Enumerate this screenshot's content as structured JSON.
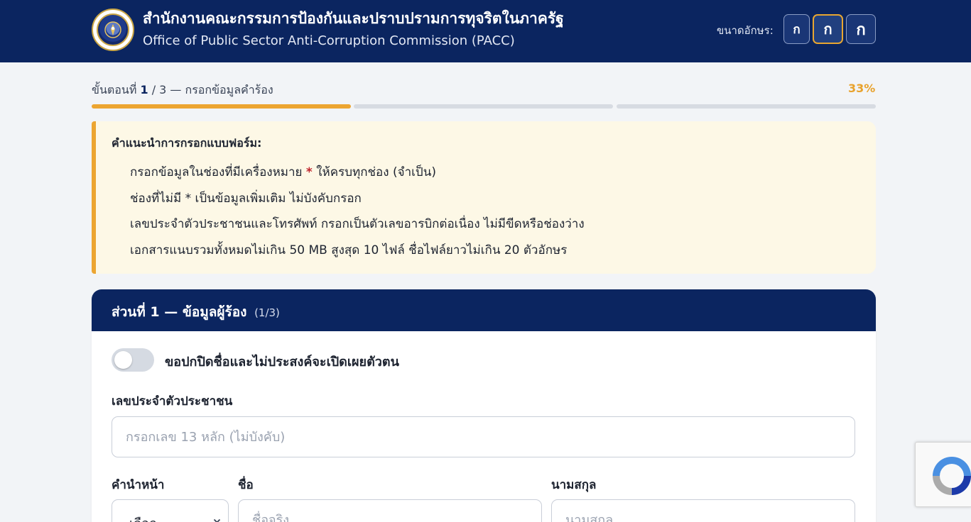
{
  "header": {
    "title_th": "สำนักงานคณะกรรมการป้องกันและปราบปรามการทุจริตในภาครัฐ",
    "title_en": "Office of Public Sector Anti-Corruption Commission (PACC)",
    "font_size_label": "ขนาดอักษร:",
    "font_size_options": [
      "ก",
      "ก",
      "ก"
    ],
    "font_size_selected_index": 1
  },
  "progress": {
    "step_prefix": "ขั้นตอนที่",
    "step_current": "1",
    "step_of": "/ 3 — กรอกข้อมูลคำร้อง",
    "percent_label": "33%",
    "percent": 33,
    "segments_total": 3,
    "segments_done": 1
  },
  "notice": {
    "title": "คำแนะนำการกรอกแบบฟอร์ม:",
    "item1_before": "กรอกข้อมูลในช่องที่มีเครื่องหมาย",
    "item1_mark": "*",
    "item1_after": "ให้ครบทุกช่อง (จำเป็น)",
    "item2": "ช่องที่ไม่มี * เป็นข้อมูลเพิ่มเติม ไม่บังคับกรอก",
    "item3": "เลขประจำตัวประชาชนและโทรศัพท์ กรอกเป็นตัวเลขอารบิกต่อเนื่อง ไม่มีขีดหรือช่องว่าง",
    "item4": "เอกสารแนบรวมทั้งหมดไม่เกิน 50 MB สูงสุด 10 ไฟล์ ชื่อไฟล์ยาวไม่เกิน 20 ตัวอักษร"
  },
  "section": {
    "title": "ส่วนที่ 1 — ข้อมูลผู้ร้อง",
    "subtitle": "(1/3)",
    "anonymous_toggle_label": "ขอปกปิดชื่อและไม่ประสงค์จะเปิดเผยตัวตน",
    "anonymous_toggle_on": false,
    "id_label": "เลขประจำตัวประชาชน",
    "id_placeholder": "กรอกเลข 13 หลัก (ไม่บังคับ)",
    "prefix_label": "คำนำหน้า",
    "prefix_value": "เลือก",
    "first_name_label": "ชื่อ",
    "first_name_placeholder": "ชื่อจริง",
    "last_name_label": "นามสกุล",
    "last_name_placeholder": "นามสกุล"
  },
  "colors": {
    "navy": "#0b2560",
    "accent": "#eca531",
    "required": "#c0262d",
    "notice_bg": "#fdf8e6"
  },
  "icons": {
    "logo": "pacc-seal-logo",
    "chevron": "chevron-down-icon",
    "captcha": "recaptcha-icon"
  }
}
